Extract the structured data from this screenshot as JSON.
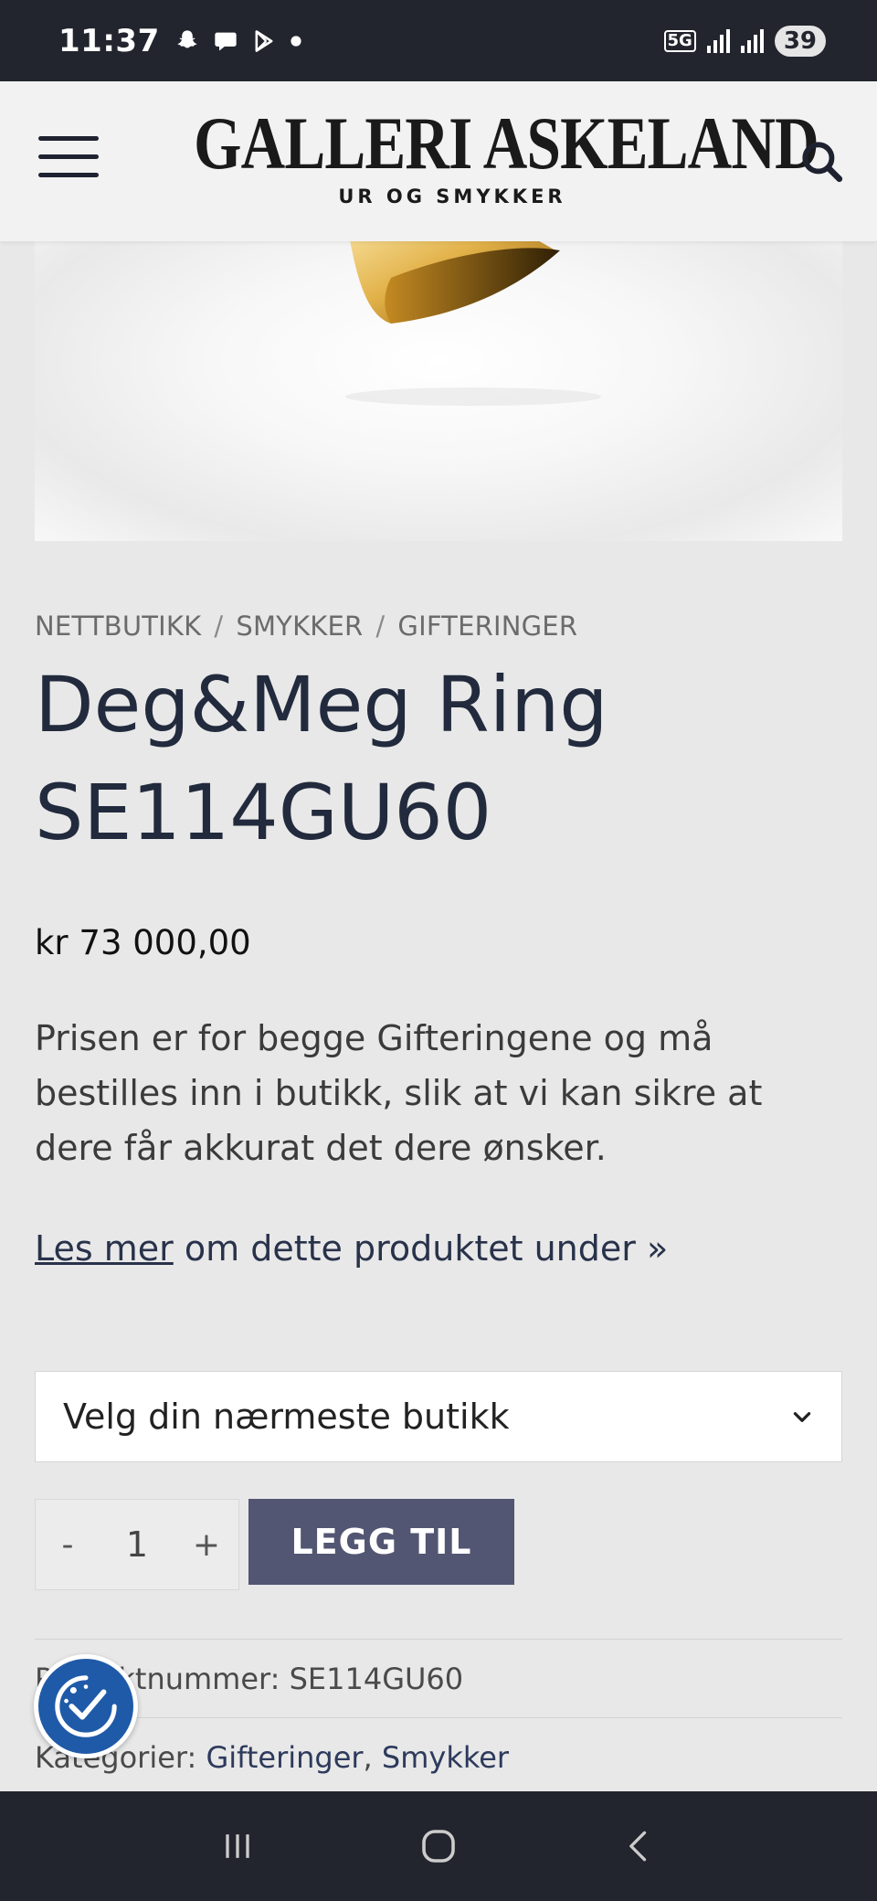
{
  "status_bar": {
    "time": "11:37",
    "notification_icons": [
      "snapchat-icon",
      "chat-bubble-icon",
      "play-store-icon",
      "dot-icon"
    ],
    "network": "5G",
    "battery": "39"
  },
  "header": {
    "logo_main": "GALLERI ASKELAND",
    "logo_sub": "UR OG SMYKKER",
    "menu_icon": "hamburger-menu-icon",
    "search_icon": "search-icon"
  },
  "breadcrumb": {
    "items": [
      "NETTBUTIKK",
      "SMYKKER",
      "GIFTERINGER"
    ],
    "separator": "/"
  },
  "product": {
    "title": "Deg&Meg Ring SE114GU60",
    "price": "kr 73 000,00",
    "description": "Prisen er for begge Gifteringene og må bestilles inn i butikk, slik at vi kan sikre at dere får akkurat det dere ønsker.",
    "read_more_link": "Les mer",
    "read_more_rest": " om dette produktet under »"
  },
  "purchase": {
    "store_select_label": "Velg din nærmeste butikk",
    "qty_minus": "-",
    "qty_value": "1",
    "qty_plus": "+",
    "add_to_cart": "LEGG TIL"
  },
  "meta": {
    "sku_label": "Produktnummer:",
    "sku_value": "SE114GU60",
    "categories_label": "Kategorier:",
    "category_1": "Gifteringer",
    "category_sep": ",",
    "category_2": "Smykker"
  },
  "colors": {
    "accent": "#525672",
    "title": "#222a3d",
    "cookie_button": "#1f5aa8",
    "system_bars": "#22252e"
  }
}
